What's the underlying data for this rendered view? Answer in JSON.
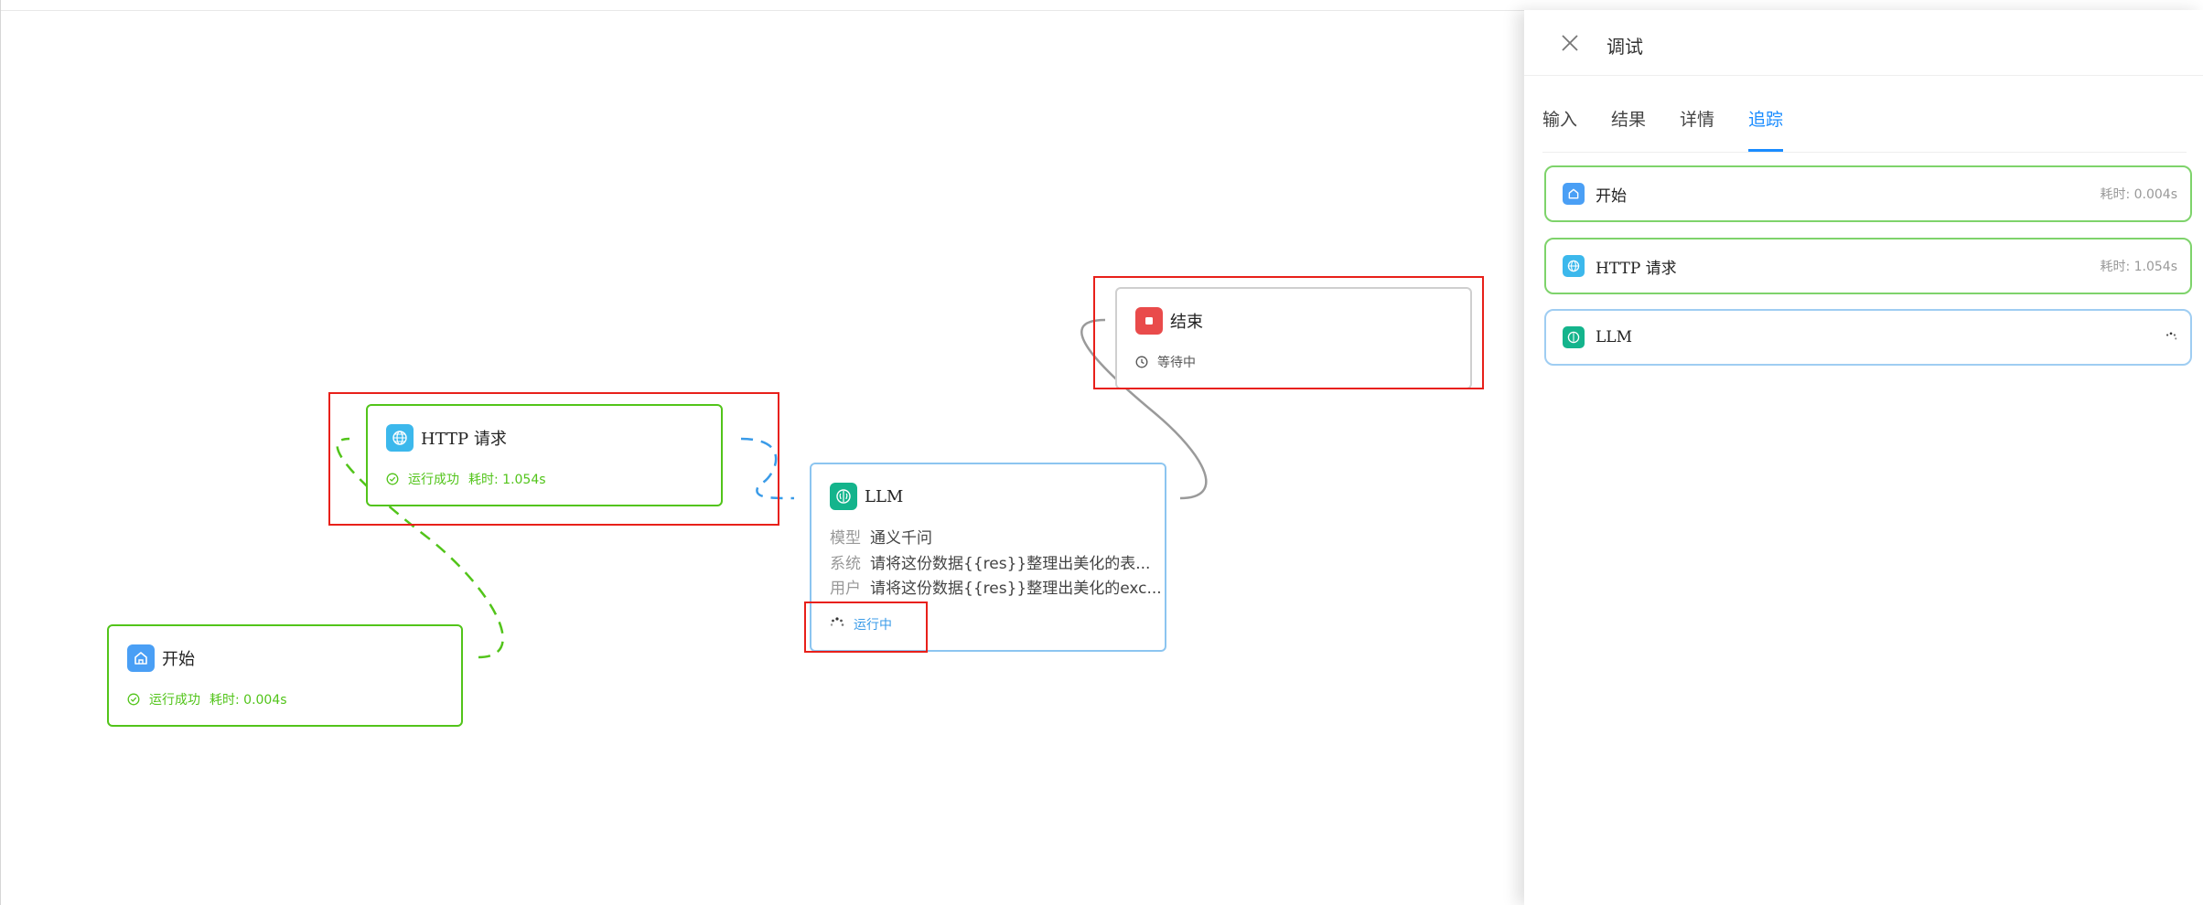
{
  "canvas": {
    "nodes": {
      "start": {
        "title": "开始",
        "status": "运行成功",
        "time_label": "耗时: 0.004s"
      },
      "http": {
        "title": "HTTP 请求",
        "status": "运行成功",
        "time_label": "耗时: 1.054s"
      },
      "llm": {
        "title": "LLM",
        "rows": [
          {
            "label": "模型",
            "value": "通义千问"
          },
          {
            "label": "系统",
            "value": "请将这份数据{{res}}整理出美化的表..."
          },
          {
            "label": "用户",
            "value": "请将这份数据{{res}}整理出美化的exc..."
          }
        ],
        "status": "运行中"
      },
      "end": {
        "title": "结束",
        "status": "等待中"
      }
    }
  },
  "panel": {
    "title": "调试",
    "tabs": [
      {
        "label": "输入",
        "active": false
      },
      {
        "label": "结果",
        "active": false
      },
      {
        "label": "详情",
        "active": false
      },
      {
        "label": "追踪",
        "active": true
      }
    ],
    "trace": [
      {
        "name": "开始",
        "time": "耗时: 0.004s",
        "state": "success"
      },
      {
        "name": "HTTP 请求",
        "time": "耗时: 1.054s",
        "state": "success"
      },
      {
        "name": "LLM",
        "time": "",
        "state": "running"
      }
    ]
  },
  "colors": {
    "success": "#52c41a",
    "running": "#3a9be8",
    "accent": "#1a8cff",
    "highlight": "#e8201a",
    "start_icon": "#4a9ff5",
    "http_icon": "#3cb8ec",
    "llm_icon": "#14b48c",
    "end_icon": "#e94b4b"
  },
  "icons": {
    "start": "home-icon",
    "http": "globe-icon",
    "llm": "brain-icon",
    "end": "stop-icon",
    "success": "check-circle-icon",
    "waiting": "clock-icon",
    "running": "spinner-icon",
    "close": "close-icon"
  }
}
